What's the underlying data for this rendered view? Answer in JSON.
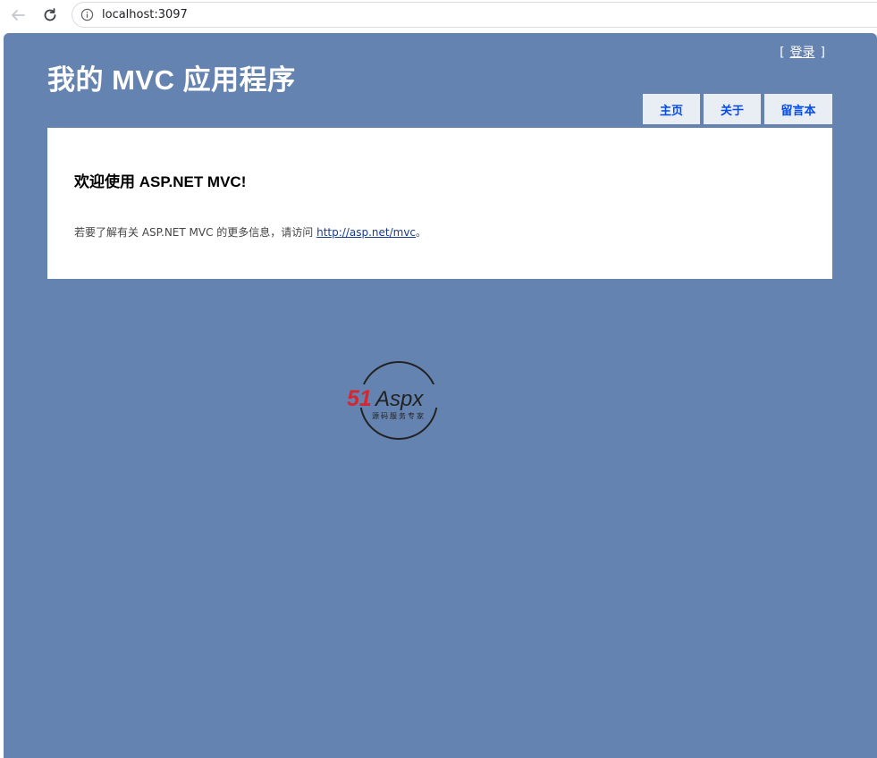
{
  "browser": {
    "url": "localhost:3097",
    "icons": [
      "back-arrow-icon",
      "reload-icon",
      "info-icon"
    ]
  },
  "header": {
    "login_open": "[",
    "login_label": "登录",
    "login_close": "]",
    "title": "我的 MVC 应用程序"
  },
  "menu": {
    "items": [
      {
        "label": "主页"
      },
      {
        "label": "关于"
      },
      {
        "label": "留言本"
      }
    ]
  },
  "main": {
    "heading": "欢迎使用 ASP.NET MVC!",
    "info_prefix": "若要了解有关 ASP.NET MVC 的更多信息，请访问 ",
    "link_text": "http://asp.net/mvc",
    "info_suffix": "。"
  },
  "watermark": {
    "brand_num": "51",
    "brand_text": "Aspx",
    "tagline": "源码服务专家"
  },
  "colors": {
    "page_bg": "#6583b0",
    "menu_bg": "#e8eef4",
    "menu_text": "#034af3",
    "logo_red": "#d8262e",
    "logo_green": "#2f9e3e"
  }
}
